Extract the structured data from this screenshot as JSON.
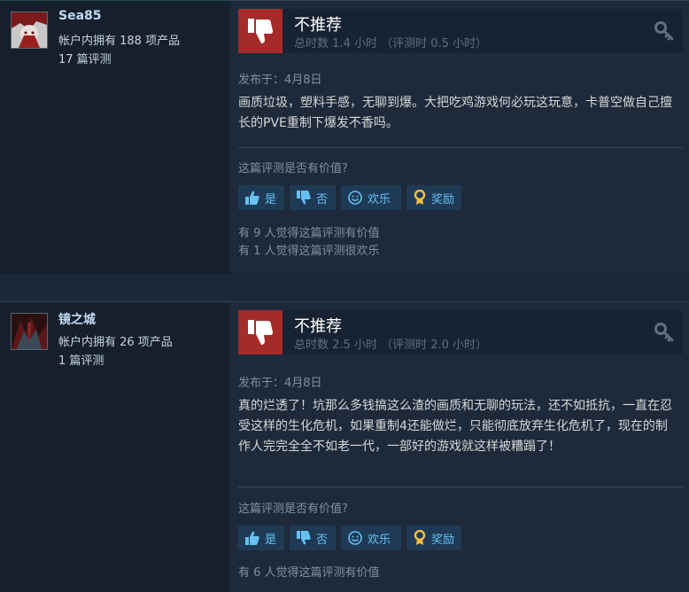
{
  "reviews": [
    {
      "username": "Sea85",
      "products": "帐户内拥有 188 项产品",
      "review_count": "17 篇评测",
      "verdict": "不推荐",
      "hours": "总时数 1.4 小时 （评测时 0.5 小时）",
      "posted": "发布于：4月8日",
      "content": "画质垃圾，塑料手感，无聊到爆。大把吃鸡游戏何必玩这玩意，卡普空做自己擅长的PVE重制下爆发不香吗。",
      "helpful_question": "这篇评测是否有价值?",
      "buttons": {
        "yes": "是",
        "no": "否",
        "funny": "欢乐",
        "award": "奖励"
      },
      "tally": [
        "有 9 人觉得这篇评测有价值",
        "有 1 人觉得这篇评测很欢乐"
      ]
    },
    {
      "username": "镜之城",
      "products": "帐户内拥有 26 项产品",
      "review_count": "1 篇评测",
      "verdict": "不推荐",
      "hours": "总时数 2.5 小时 （评测时 2.0 小时）",
      "posted": "发布于：4月8日",
      "content": "真的烂透了！坑那么多钱搞这么渣的画质和无聊的玩法，还不如抵抗，一直在忍受这样的生化危机，如果重制4还能做烂，只能彻底放弃生化危机了，现在的制作人完完全全不如老一代，一部好的游戏就这样被糟蹋了！",
      "helpful_question": "这篇评测是否有价值?",
      "buttons": {
        "yes": "是",
        "no": "否",
        "funny": "欢乐",
        "award": "奖励"
      },
      "tally": [
        "有 6 人觉得这篇评测有价值"
      ]
    }
  ],
  "icons": {
    "verdict": "thumbs-down-icon",
    "key": "key-icon",
    "yes": "thumbs-up-icon",
    "no": "thumbs-down-small-icon",
    "funny": "smiley-icon",
    "award": "award-ribbon-icon"
  },
  "colors": {
    "background": "#1b2838",
    "negative": "#a52a2a",
    "button_text": "#66c0f4",
    "username": "#c1dbf4"
  }
}
